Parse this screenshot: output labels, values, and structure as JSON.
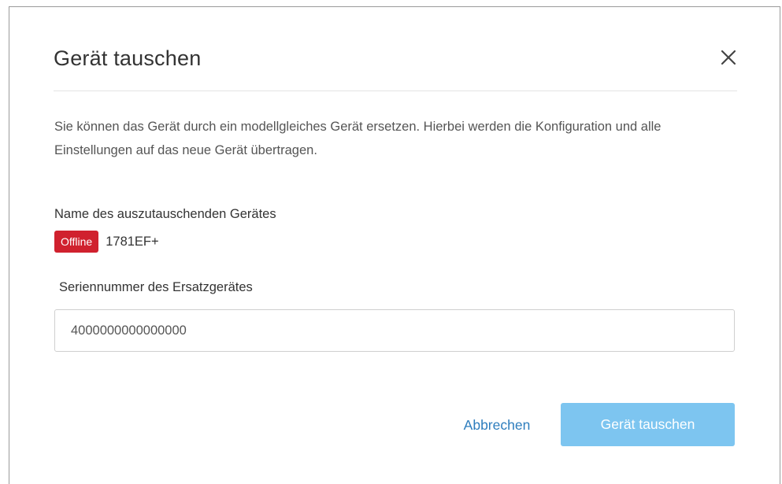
{
  "dialog": {
    "title": "Gerät tauschen",
    "close_icon": "close-icon",
    "description": "Sie können das Gerät durch ein modellgleiches Gerät ersetzen. Hierbei werden die Konfiguration und alle Einstellungen auf das neue Gerät übertragen.",
    "device": {
      "label": "Name des auszutauschenden Gerätes",
      "status": "Offline",
      "status_color": "#d0212e",
      "name": "1781EF+"
    },
    "serial": {
      "label": "Seriennummer des Ersatzgerätes",
      "value": "4000000000000000"
    },
    "actions": {
      "cancel_label": "Abbrechen",
      "submit_label": "Gerät tauschen",
      "link_color": "#2d7dbd",
      "submit_color": "#7dc5f0"
    }
  }
}
